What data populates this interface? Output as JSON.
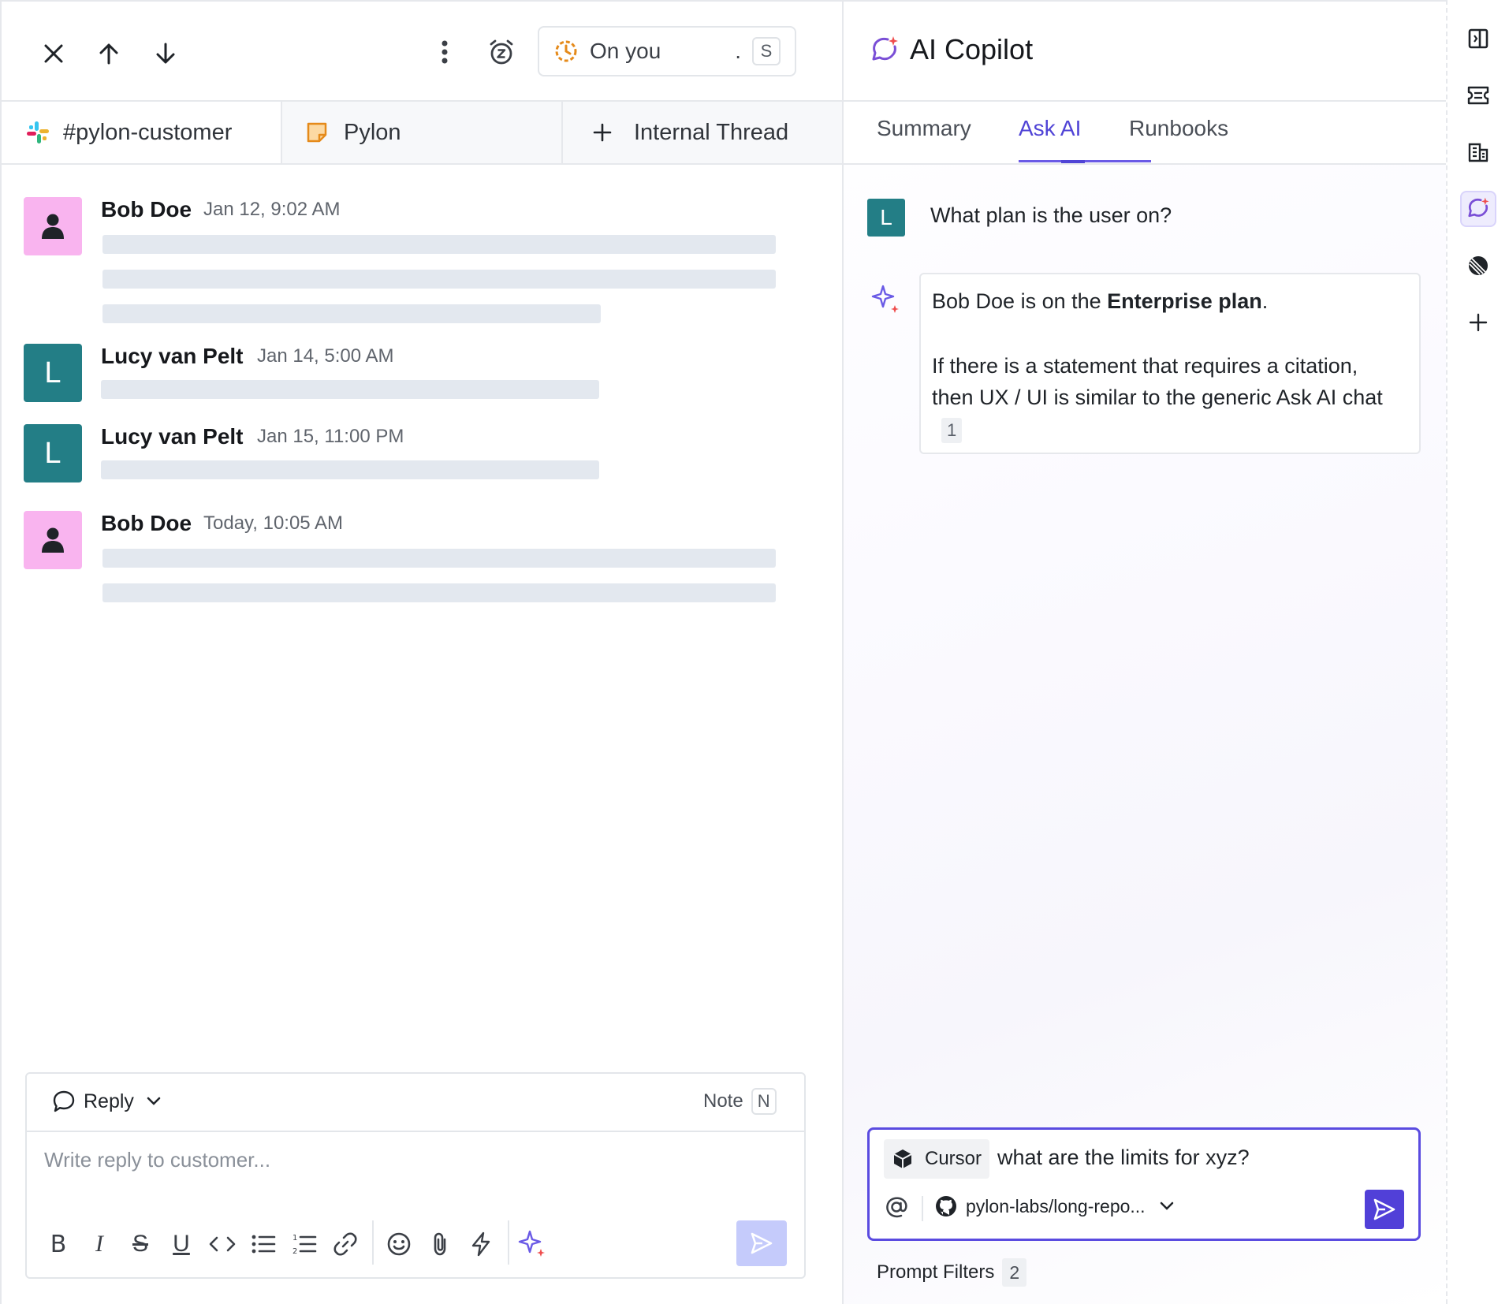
{
  "status": {
    "label": "On you",
    "dot": ".",
    "shortcut": "S"
  },
  "channel_tabs": [
    {
      "label": "#pylon-customer",
      "icon": "slack-icon"
    },
    {
      "label": "Pylon",
      "icon": "note-icon"
    },
    {
      "label": "Internal Thread",
      "icon": "plus-icon"
    }
  ],
  "messages": [
    {
      "author": "Bob Doe",
      "time": "Jan 12, 9:02 AM",
      "avatar": "person"
    },
    {
      "author": "Lucy van Pelt",
      "time": "Jan 14, 5:00 AM",
      "avatar": "L"
    },
    {
      "author": "Lucy van Pelt",
      "time": "Jan 15, 11:00 PM",
      "avatar": "L"
    },
    {
      "author": "Bob Doe",
      "time": "Today, 10:05 AM",
      "avatar": "person"
    }
  ],
  "composer": {
    "mode_label": "Reply",
    "note_label": "Note",
    "note_shortcut": "N",
    "placeholder": "Write reply to customer..."
  },
  "copilot": {
    "title": "AI Copilot",
    "tabs": [
      "Summary",
      "Ask AI",
      "Runbooks"
    ],
    "question_avatar": "L",
    "question": "What plan is the user on?",
    "answer_prefix": "Bob Doe is on the ",
    "answer_bold": "Enterprise plan",
    "answer_suffix": ".",
    "answer_para2": "If there is a statement that requires a citation, then UX / UI is similar to the generic Ask AI chat",
    "citation": "1",
    "input": {
      "source_chip": "Cursor",
      "query": "what are the limits for xyz?",
      "repo": "pylon-labs/long-repo..."
    },
    "prompt_filters_label": "Prompt Filters",
    "prompt_filters_count": "2"
  },
  "colors": {
    "accent": "#5a4be0",
    "teal": "#237e86",
    "pink_avatar": "#f9b4ef",
    "skeleton": "#e3e8ef",
    "send_disabled": "#c5cbfb"
  }
}
